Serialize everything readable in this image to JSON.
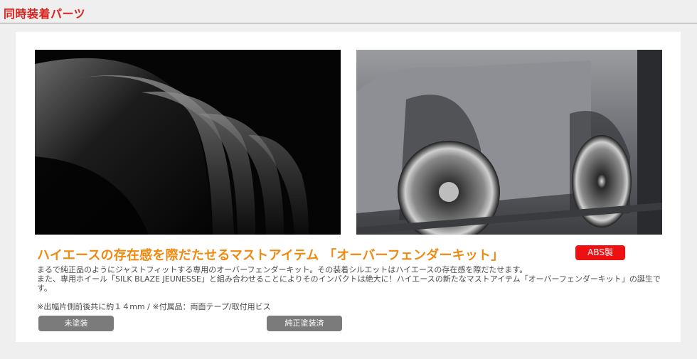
{
  "header": {
    "title": "同時装着パーツ"
  },
  "product": {
    "headline": "ハイエースの存在感を際だたせるマストアイテム 「オーバーフェンダーキット」",
    "badge": "ABS製",
    "description_lines": [
      "まるで純正品のようにジャストフィットする専用のオーバーフェンダーキット。その装着シルエットはハイエースの存在感を際だたせます。",
      "また、専用ホイール「SILK BLAZE JEUNESSE」と組み合わせることによりそのインパクトは絶大に！ハイエースの新たなマストアイテム「オーバーフェンダーキット」の誕生です。"
    ],
    "note": "※出幅片側前後共に約１４mm / ※付属品：両面テープ/取付用ビス",
    "buttons": {
      "unpainted": "未塗装",
      "painted": "純正塗装済"
    }
  },
  "colors": {
    "header_title": "#d9221e",
    "headline": "#ee8a12",
    "badge": "#ee1111",
    "button": "#7b7b7b"
  }
}
